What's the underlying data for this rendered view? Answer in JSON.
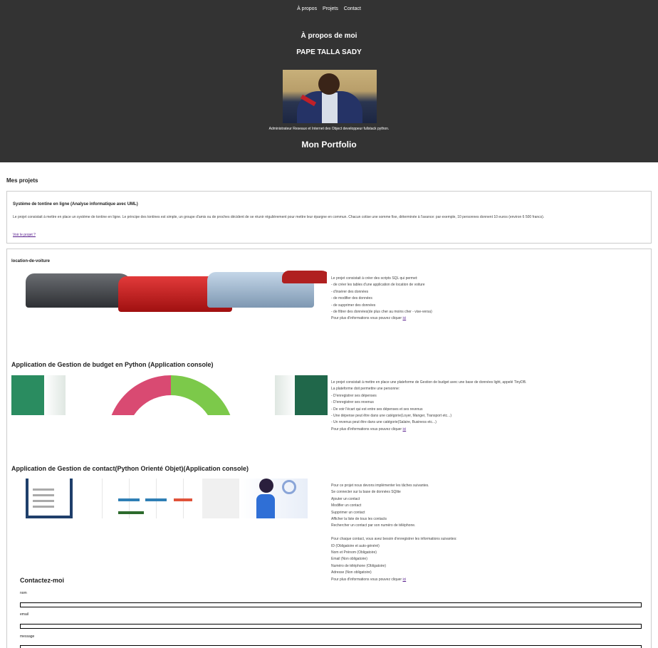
{
  "nav": {
    "items": [
      "À propos",
      "Projets",
      "Contact"
    ]
  },
  "about": {
    "title": "À propos de moi",
    "name": "PAPE TALLA SADY",
    "role": "Administrateur Reseaux et Internet des Object developpeur fullstack python.",
    "portfolio": "Mon Portfolio"
  },
  "projects": {
    "section_title": "Mes projets",
    "p1": {
      "title": "Système de tontine en ligne (Analyse informatique avec UML)",
      "text": "Le projet consistait à mettre en place un système de tontine en ligne. Le principe des tontines est simple, un groupe d'amis ou de proches décident de se réunir régulièrement pour mettre leur épargne en commun. Chacun cotise une somme fixe, déterminée à l'avance: par exemple, 10 personnes donnent 10 euros (environ 6 500 francs).",
      "link": "Voir le projet ?"
    },
    "p2": {
      "title": "location-de-voiture",
      "lines": [
        "Le projet consistait à créer des scripts SQL qui permet:",
        "- de créer les tables d'une application de location de voiture",
        "- d'insérer des données",
        "- de modifier des données",
        "- de supprimer des données",
        "- de filtrer des données(de plus cher au moins cher - vise-versa)"
      ],
      "more": "Pour plus d'informations vous pouvez cliquer",
      "link": "ici"
    },
    "p3": {
      "title": "Application de Gestion de budget en Python (Application console)",
      "lines": [
        "Le projet consistait à mettre en place une plateforme de Gestion de budget avec une base de données light, appelé TinyDB.",
        "La plateforme doit permettre une personne:",
        "- D'enregistrer ses dépenses",
        "- D'enregistrer ses revenus",
        "- De voir l'écart qui est entre ses dépenses et ses revenus",
        "- Une dépense peut être dans une catégorie(Loyer, Manger, Transport etc...)",
        "- Un revenus peut être dans une catégorie(Salaire, Business etc...)"
      ],
      "more": "Pour plus d'informations vous pouvez cliquer",
      "link": "ici"
    },
    "p4": {
      "title": "Application de Gestion de contact(Python Orienté Objet)(Application console)",
      "lines": [
        "Pour ce projet nous devons implémenter les tâches suivantes.",
        "Se connecter sur la base de données SQlite",
        "Ajouter un contact",
        "Modifier un contact",
        "Supprimer un contact",
        "Afficher la liste de tous les contacts",
        "Rechercher un contact par son numéro de téléphone.",
        "",
        "Pour chaque contact, vous avez besoin d'enregistrer les informations suivantes:",
        "ID (Obligatoire et auto-généré)",
        "Nom et Prénom (Obligatoire)",
        "Email (Non obligatoire)",
        "Numéro de téléphone (Obligatoire)",
        "Adresse (Non obligatoire)"
      ],
      "more": "Pour plus d'informations vous pouvez cliquer",
      "link": "ici"
    }
  },
  "contact": {
    "title": "Contactez-moi",
    "nom": "nom",
    "email": "email",
    "message": "message"
  },
  "colors": {
    "header_bg": "#333333",
    "link": "#551a8b"
  }
}
